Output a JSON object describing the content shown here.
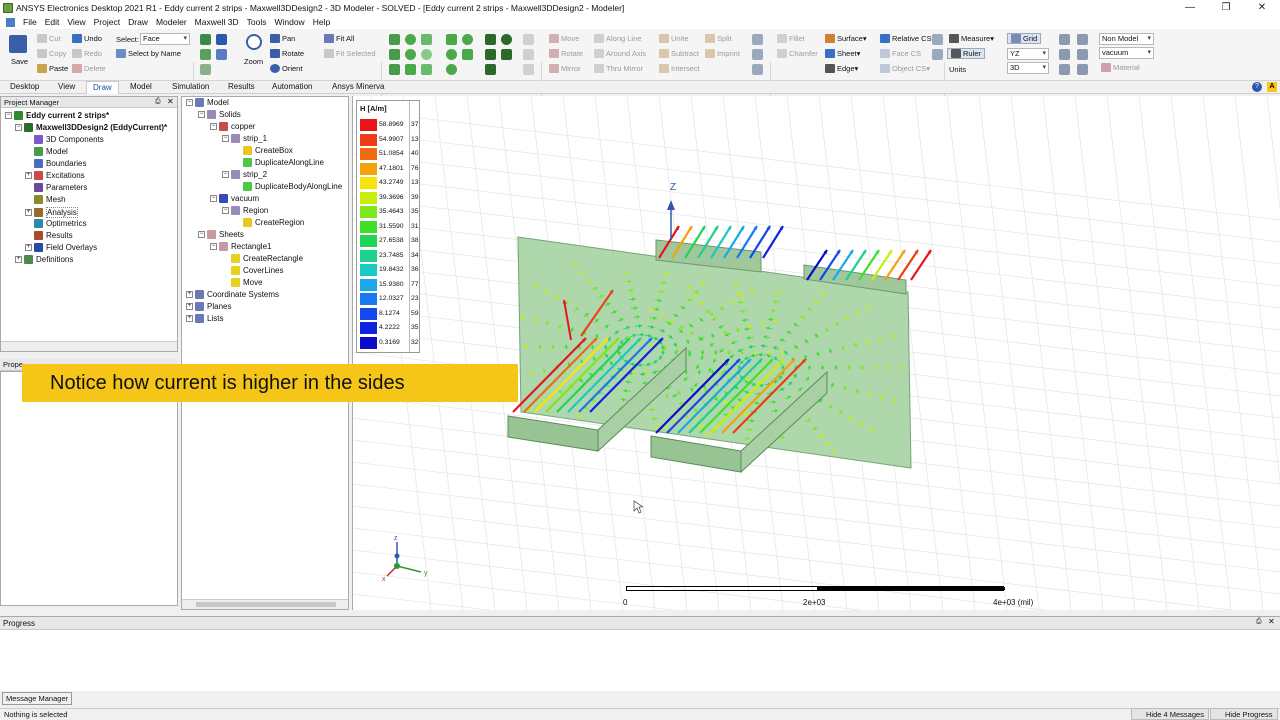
{
  "window": {
    "title": "ANSYS Electronics Desktop 2021 R1 - Eddy current 2 strips - Maxwell3DDesign2 - 3D Modeler - SOLVED - [Eddy current 2 strips - Maxwell3DDesign2 - Modeler]"
  },
  "menu": [
    "File",
    "Edit",
    "View",
    "Project",
    "Draw",
    "Modeler",
    "Maxwell 3D",
    "Tools",
    "Window",
    "Help"
  ],
  "ribbon": {
    "save": "Save",
    "cut": "Cut",
    "copy": "Copy",
    "paste": "Paste",
    "undo": "Undo",
    "redo": "Redo",
    "delete": "Delete",
    "select_label": "Select:",
    "select_value": "Face",
    "select_by_name": "Select by Name",
    "zoom": "Zoom",
    "pan": "Pan",
    "rotate": "Rotate",
    "orient": "Orient",
    "fit_all": "Fit All",
    "fit_selected": "Fit Selected",
    "move": "Move",
    "rotate2": "Rotate",
    "mirror": "Mirror",
    "along_line": "Along Line",
    "around_axis": "Around Axis",
    "thru_mirror": "Thru Mirror",
    "unite": "Unite",
    "subtract": "Subtract",
    "intersect": "Intersect",
    "split": "Split",
    "imprint": "Imprint",
    "fillet": "Fillet",
    "chamfer": "Chamfer",
    "surface": "Surface",
    "sheet": "Sheet",
    "edge": "Edge",
    "relative_cs": "Relative CS",
    "face_cs": "Face CS",
    "object_cs": "Object CS",
    "measure": "Measure",
    "ruler": "Ruler",
    "units": "Units",
    "grid": "Grid",
    "plane": "YZ",
    "dim": "3D",
    "non_model": "Non Model",
    "material_value": "vacuum",
    "material": "Material"
  },
  "tabs": [
    "Desktop",
    "View",
    "Draw",
    "Model",
    "Simulation",
    "Results",
    "Automation",
    "Ansys Minerva"
  ],
  "project_manager": {
    "title": "Project Manager",
    "nodes": [
      {
        "label": "Eddy current 2 strips*",
        "level": 0,
        "bold": true,
        "icon": "project-icon"
      },
      {
        "label": "Maxwell3DDesign2 (EddyCurrent)*",
        "level": 1,
        "bold": true,
        "icon": "design-icon"
      },
      {
        "label": "3D Components",
        "level": 2,
        "icon": "components-icon"
      },
      {
        "label": "Model",
        "level": 2,
        "icon": "model-icon"
      },
      {
        "label": "Boundaries",
        "level": 2,
        "icon": "boundaries-icon"
      },
      {
        "label": "Excitations",
        "level": 2,
        "icon": "excitations-icon"
      },
      {
        "label": "Parameters",
        "level": 2,
        "icon": "parameters-icon"
      },
      {
        "label": "Mesh",
        "level": 2,
        "icon": "mesh-icon"
      },
      {
        "label": "Analysis",
        "level": 2,
        "icon": "analysis-icon"
      },
      {
        "label": "Optimetrics",
        "level": 2,
        "icon": "optimetrics-icon"
      },
      {
        "label": "Results",
        "level": 2,
        "icon": "results-icon"
      },
      {
        "label": "Field Overlays",
        "level": 2,
        "icon": "field-overlays-icon"
      },
      {
        "label": "Definitions",
        "level": 1,
        "icon": "definitions-icon"
      }
    ]
  },
  "properties_title": "Prope",
  "model_tree": [
    {
      "label": "Model",
      "level": 0
    },
    {
      "label": "Solids",
      "level": 1
    },
    {
      "label": "copper",
      "level": 2
    },
    {
      "label": "strip_1",
      "level": 3
    },
    {
      "label": "CreateBox",
      "level": 4
    },
    {
      "label": "DuplicateAlongLine",
      "level": 4
    },
    {
      "label": "strip_2",
      "level": 3
    },
    {
      "label": "DuplicateBodyAlongLine",
      "level": 4
    },
    {
      "label": "vacuum",
      "level": 2
    },
    {
      "label": "Region",
      "level": 3
    },
    {
      "label": "CreateRegion",
      "level": 4
    },
    {
      "label": "Sheets",
      "level": 1
    },
    {
      "label": "Rectangle1",
      "level": 2
    },
    {
      "label": "CreateRectangle",
      "level": 3
    },
    {
      "label": "CoverLines",
      "level": 3
    },
    {
      "label": "Move",
      "level": 3
    },
    {
      "label": "Coordinate Systems",
      "level": 0
    },
    {
      "label": "Planes",
      "level": 0
    },
    {
      "label": "Lists",
      "level": 0
    }
  ],
  "legend": {
    "title": "H [A/m]",
    "values": [
      "58.8969",
      "54.9907",
      "51.0854",
      "47.1801",
      "43.2749",
      "39.3696",
      "35.4643",
      "31.5590",
      "27.6538",
      "23.7485",
      "19.8432",
      "15.9380",
      "12.0327",
      "8.1274",
      "4.2222",
      "0.3169"
    ],
    "counts": [
      "37",
      "13",
      "40",
      "76",
      "13",
      "39",
      "35",
      "31",
      "38",
      "34",
      "36",
      "77",
      "23",
      "59",
      "35",
      "32"
    ],
    "colors": [
      "#e8141c",
      "#ef3c14",
      "#f06a10",
      "#f4a10c",
      "#f8e30a",
      "#c8ef0c",
      "#7ee81a",
      "#3ee02c",
      "#22d454",
      "#1ed08e",
      "#1ac8c4",
      "#1aa8e8",
      "#1878f0",
      "#1448ec",
      "#1024e0",
      "#0c0cc8"
    ]
  },
  "caption": "Notice how current is higher in the sides",
  "axis_label": "Z",
  "scale": {
    "start": "0",
    "mid": "2e+03",
    "end": "4e+03 (mil)"
  },
  "progress_title": "Progress",
  "message_manager": "Message Manager",
  "status_text": "Nothing is selected",
  "hide_messages": "Hide 4 Messages",
  "hide_progress": "Hide Progress",
  "colors": {
    "ribbon_bg": "#f5f5f5",
    "caption_bg": "#f5c518",
    "sheet": "#a6d4a4",
    "strip": "#a0c89c",
    "accent": "#1a4fa0"
  }
}
